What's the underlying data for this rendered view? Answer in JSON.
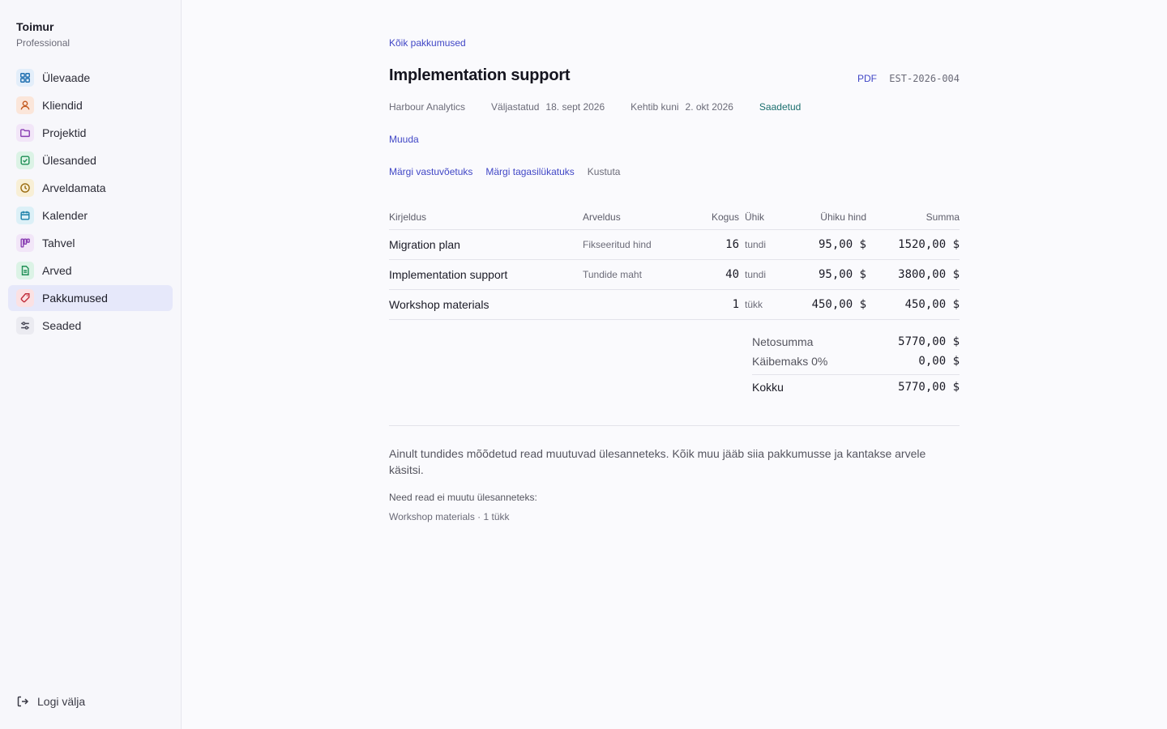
{
  "brand": {
    "name": "Toimur",
    "plan": "Professional"
  },
  "nav": [
    {
      "label": "Ülevaade",
      "icon": "grid-icon",
      "color": "#1f6fb0",
      "bg": "#e3eefa",
      "active": false
    },
    {
      "label": "Kliendid",
      "icon": "user-icon",
      "color": "#c2571d",
      "bg": "#fbe6da",
      "active": false
    },
    {
      "label": "Projektid",
      "icon": "folder-icon",
      "color": "#8a3fb3",
      "bg": "#f2e6f8",
      "active": false
    },
    {
      "label": "Ülesanded",
      "icon": "check-square-icon",
      "color": "#1f8f55",
      "bg": "#dcf3e6",
      "active": false
    },
    {
      "label": "Arveldamata",
      "icon": "clock-icon",
      "color": "#9a6b0f",
      "bg": "#f8efd6",
      "active": false
    },
    {
      "label": "Kalender",
      "icon": "calendar-icon",
      "color": "#1a7fa8",
      "bg": "#dcf0f7",
      "active": false
    },
    {
      "label": "Tahvel",
      "icon": "kanban-icon",
      "color": "#8a3fb3",
      "bg": "#f2e6f8",
      "active": false
    },
    {
      "label": "Arved",
      "icon": "document-icon",
      "color": "#1f8f55",
      "bg": "#dcf3e6",
      "active": false
    },
    {
      "label": "Pakkumused",
      "icon": "tag-icon",
      "color": "#c02c3a",
      "bg": "#fbe1e3",
      "active": true
    },
    {
      "label": "Seaded",
      "icon": "sliders-icon",
      "color": "#4a4a58",
      "bg": "#ebebf1",
      "active": false
    }
  ],
  "logout": {
    "label": "Logi välja"
  },
  "page": {
    "breadcrumb": "Kõik pakkumused",
    "title": "Implementation support",
    "pdf_label": "PDF",
    "estimate_number": "EST-2026-004",
    "client": "Harbour Analytics",
    "issued_label": "Väljastatud",
    "issued_date": "18. sept 2026",
    "valid_label": "Kehtib kuni",
    "valid_date": "2. okt 2026",
    "status": "Saadetud",
    "edit_label": "Muuda",
    "actions": {
      "accept": "Märgi vastuvõetuks",
      "decline": "Märgi tagasilükatuks",
      "delete": "Kustuta"
    }
  },
  "table": {
    "headers": {
      "description": "Kirjeldus",
      "billing": "Arveldus",
      "quantity": "Kogus",
      "unit": "Ühik",
      "unit_price": "Ühiku hind",
      "total": "Summa"
    },
    "rows": [
      {
        "description": "Migration plan",
        "billing": "Fikseeritud hind",
        "quantity": "16",
        "unit": "tundi",
        "unit_price": "95,00 $",
        "total": "1520,00 $"
      },
      {
        "description": "Implementation support",
        "billing": "Tundide maht",
        "quantity": "40",
        "unit": "tundi",
        "unit_price": "95,00 $",
        "total": "3800,00 $"
      },
      {
        "description": "Workshop materials",
        "billing": "",
        "quantity": "1",
        "unit": "tükk",
        "unit_price": "450,00 $",
        "total": "450,00 $"
      }
    ]
  },
  "totals": {
    "net_label": "Netosumma",
    "net_value": "5770,00 $",
    "vat_label": "Käibemaks 0%",
    "vat_value": "0,00 $",
    "total_label": "Kokku",
    "total_value": "5770,00 $"
  },
  "notes": {
    "main": "Ainult tundides mõõdetud read muutuvad ülesanneteks. Kõik muu jääb siia pakkumusse ja kantakse arvele käsitsi.",
    "sub_heading": "Need read ei muutu ülesanneteks:",
    "sub_item": "Workshop materials · 1 tükk"
  }
}
